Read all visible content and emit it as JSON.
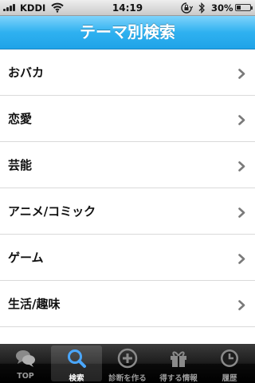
{
  "status_bar": {
    "carrier": "KDDI",
    "time": "14:19",
    "battery": "30%",
    "battery_level": 0.3,
    "icons": [
      "signal-icon",
      "wifi-icon",
      "rotation-lock-icon",
      "bluetooth-icon",
      "battery-icon"
    ]
  },
  "nav": {
    "title": "テーマ別検索"
  },
  "list": {
    "items": [
      {
        "label": "おバカ"
      },
      {
        "label": "恋愛"
      },
      {
        "label": "芸能"
      },
      {
        "label": "アニメ/コミック"
      },
      {
        "label": "ゲーム"
      },
      {
        "label": "生活/趣味"
      },
      {
        "label": ""
      }
    ]
  },
  "tabs": [
    {
      "label": "TOP",
      "icon": "chat-bubbles-icon",
      "active": false
    },
    {
      "label": "検索",
      "icon": "search-icon",
      "active": true
    },
    {
      "label": "診断を作る",
      "icon": "plus-circle-icon",
      "active": false
    },
    {
      "label": "得する情報",
      "icon": "gift-icon",
      "active": false
    },
    {
      "label": "履歴",
      "icon": "clock-icon",
      "active": false
    }
  ],
  "colors": {
    "nav_accent": "#2fb1f0",
    "tab_bar": "#1c1c1c",
    "chevron": "#7a7a7a"
  }
}
